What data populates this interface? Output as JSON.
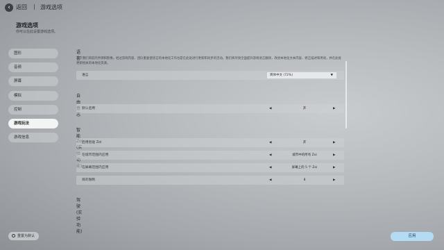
{
  "header": {
    "back_icon": "chevron-left-icon",
    "back_label": "返回",
    "separator": "|",
    "breadcrumb": "游戏选项"
  },
  "page": {
    "title": "游戏选项",
    "subtitle": "你可以在此设置游戏选项。"
  },
  "sidebar": {
    "items": [
      {
        "label": "图形",
        "active": false
      },
      {
        "label": "音频",
        "active": false
      },
      {
        "label": "屏幕",
        "active": false
      },
      {
        "label": "模拟",
        "active": false
      },
      {
        "label": "控制",
        "active": false
      },
      {
        "label": "游戏玩法",
        "active": true
      },
      {
        "label": "游戏信息",
        "active": false
      }
    ]
  },
  "sections": {
    "language": {
      "title": "语言",
      "description": "基于我们目前的手牌和影像，经过游戏内容、团队重复使语言的本地化工作也是在此处进行更新和同步的活动。我们将尽快全面提升游戏语言翻译，改进本地化文本内容、修正描述和用语，并在此处更新相关的本地化资源。",
      "row_label": "语言",
      "selected": "简体中文 (72%)"
    },
    "freecam": {
      "title": "自由意志",
      "rows": [
        {
          "label": "默认启用",
          "value": "开"
        }
      ]
    },
    "zoi": {
      "title": "智能 Zoi (实验功能)",
      "rows": [
        {
          "label": "启用智能 Zoi",
          "value": "开"
        },
        {
          "label": "在城市范围内应用",
          "value": "城市中的所有 Zoi"
        },
        {
          "label": "在屏幕范围内应用",
          "value": "屏幕上的 5 个 Zoi"
        },
        {
          "label": "目的限制",
          "value": "8"
        }
      ]
    },
    "driving": {
      "title": "驾驶 (实验功能)"
    }
  },
  "footer": {
    "reset_label": "重置为默认",
    "apply_label": "应用"
  },
  "colors": {
    "apply_button": "#b3dcf4",
    "active_nav": "#f3f4f4"
  }
}
